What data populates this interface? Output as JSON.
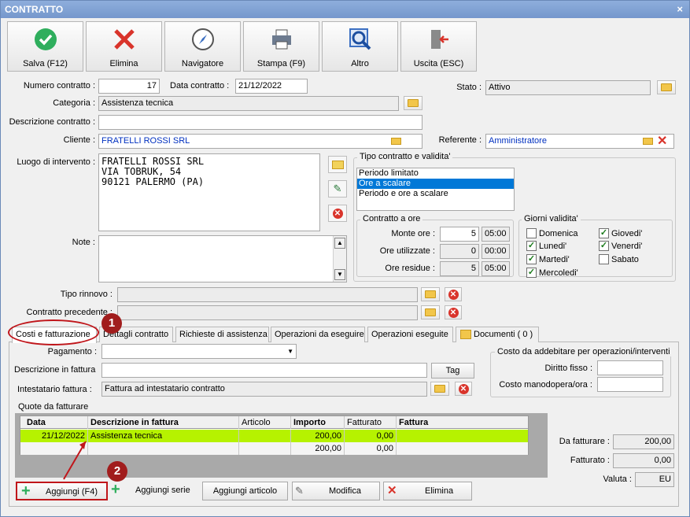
{
  "window": {
    "title": "CONTRATTO",
    "close": "×"
  },
  "toolbar": [
    {
      "label": "Salva (F12)",
      "icon": "check-icon"
    },
    {
      "label": "Elimina",
      "icon": "delete-icon"
    },
    {
      "label": "Navigatore",
      "icon": "compass-icon"
    },
    {
      "label": "Stampa (F9)",
      "icon": "printer-icon"
    },
    {
      "label": "Altro",
      "icon": "magnifier-icon"
    },
    {
      "label": "Uscita (ESC)",
      "icon": "exit-door-icon"
    }
  ],
  "form": {
    "numero_label": "Numero contratto :",
    "numero": "17",
    "data_label": "Data contratto :",
    "data": "21/12/2022",
    "stato_label": "Stato :",
    "stato": "Attivo",
    "categoria_label": "Categoria :",
    "categoria": "Assistenza tecnica",
    "descrizione_label": "Descrizione contratto :",
    "descrizione": "",
    "cliente_label": "Cliente :",
    "cliente": "FRATELLI ROSSI SRL",
    "referente_label": "Referente :",
    "referente": "Amministratore",
    "luogo_label": "Luogo di intervento :",
    "luogo_lines": [
      "FRATELLI ROSSI SRL",
      "VIA TOBRUK, 54",
      "90121 PALERMO (PA)"
    ],
    "note_label": "Note :",
    "tipo_rinnovo_label": "Tipo rinnovo :",
    "contratto_precedente_label": "Contratto precedente :"
  },
  "tipo_contratto": {
    "title": "Tipo contratto e validita'",
    "options": [
      "Periodo limitato",
      "Ore a scalare",
      "Periodo e ore a scalare"
    ],
    "selected": "Ore a scalare"
  },
  "contratto_ore": {
    "title": "Contratto a ore",
    "monte_label": "Monte ore :",
    "monte": "5",
    "monte_time": "05:00",
    "utilizzate_label": "Ore utilizzate :",
    "utilizzate": "0",
    "utilizzate_time": "00:00",
    "residue_label": "Ore residue :",
    "residue": "5",
    "residue_time": "05:00"
  },
  "giorni": {
    "title": "Giorni validita'",
    "days": [
      {
        "label": "Domenica",
        "checked": false
      },
      {
        "label": "Lunedi'",
        "checked": true
      },
      {
        "label": "Martedi'",
        "checked": true
      },
      {
        "label": "Mercoledi'",
        "checked": true
      },
      {
        "label": "Giovedi'",
        "checked": true
      },
      {
        "label": "Venerdi'",
        "checked": true
      },
      {
        "label": "Sabato",
        "checked": false
      }
    ]
  },
  "tabs": [
    "Costi e fatturazione",
    "Dettagli contratto",
    "Richieste di assistenza",
    "Operazioni da eseguire",
    "Operazioni eseguite",
    "Documenti ( 0 )"
  ],
  "billing": {
    "pagamento_label": "Pagamento :",
    "descr_fattura_label": "Descrizione in fattura",
    "tag_button": "Tag",
    "intestatario_label": "Intestatario fattura :",
    "intestatario": "Fattura ad intestatario contratto",
    "costo_title": "Costo da addebitare per operazioni/interventi",
    "diritto_label": "Diritto fisso :",
    "manodopera_label": "Costo manodopera/ora :",
    "quote_label": "Quote da fatturare"
  },
  "grid": {
    "columns": [
      "Data",
      "Descrizione in fattura",
      "Articolo",
      "Importo",
      "Fatturato",
      "Fattura"
    ],
    "rows": [
      [
        "21/12/2022",
        "Assistenza tecnica",
        "",
        "200,00",
        "0,00",
        ""
      ],
      [
        "",
        "",
        "",
        "200,00",
        "0,00",
        ""
      ]
    ]
  },
  "totals": {
    "da_fatturare_label": "Da fatturare :",
    "da_fatturare": "200,00",
    "fatturato_label": "Fatturato :",
    "fatturato": "0,00",
    "valuta_label": "Valuta :",
    "valuta": "EU"
  },
  "bottom_buttons": [
    "Aggiungi (F4)",
    "Aggiungi serie",
    "Aggiungi articolo",
    "Modifica",
    "Elimina"
  ],
  "badges": [
    "1",
    "2"
  ],
  "colors": {
    "accent": "#0078d7",
    "highlight_row": "#b6f200",
    "annotation": "#c0161b"
  }
}
